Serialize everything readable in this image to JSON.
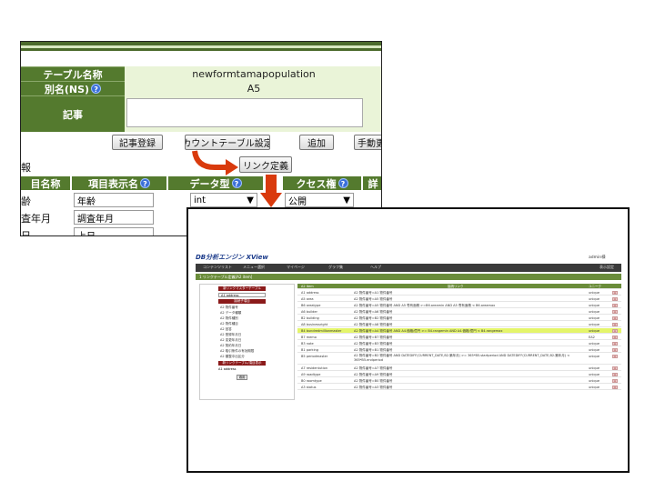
{
  "top": {
    "table_name_label": "テーブル名称",
    "table_name_value": "newformtamapopulation",
    "alias_label": "別名(NS)",
    "alias_value": "A5",
    "article_label": "記事",
    "buttons": {
      "register_article": "記事登録",
      "count_table": "カウントテーブル設定",
      "add": "追加",
      "manual": "手動更"
    },
    "section_label": "報",
    "link_def": "リンク定義",
    "columns": {
      "item_name": "目名称",
      "item_display": "項目表示名",
      "data_type": "データ型",
      "access": "クセス権",
      "extra": "詳"
    },
    "rows": [
      {
        "name": "齢",
        "display": "年齢",
        "type": "int",
        "access": "公開"
      },
      {
        "name": "査年月",
        "display": "調査年月",
        "type": "",
        "access": ""
      },
      {
        "name": "日",
        "display": "上日",
        "type": "",
        "access": ""
      }
    ],
    "colors": {
      "header_green": "#547a2e",
      "value_bg": "#eaf4d8",
      "arrow": "#d93a0d"
    }
  },
  "app": {
    "title": "DB分析エンジン XView",
    "user": "admin様",
    "nav": [
      "コンテンツリスト",
      "メニュー選択",
      "マイページ",
      "グラフ集",
      "ヘルプ"
    ],
    "nav_right": "表示設定",
    "breadcrumb": "1 リンクテーブル定義[A2 item]",
    "left_panel": {
      "btn_source": "新リンクマスターテーブル",
      "select_value": "A1 address",
      "btn_field": "接続子項目",
      "items": [
        "A2 物件番号",
        "A2 データ種類",
        "A2 物件種別",
        "A2 物件種目",
        "A2 回答",
        "A2 登録年月日",
        "A2 変更年月日",
        "A2 契約年月日",
        "A2 取引条件の有効期限",
        "A2 類整中出区分"
      ],
      "btn_target": "新リンクテーブル/項目表示",
      "select_value2": "A1 address",
      "apply": "適用"
    },
    "table_headers": [
      "A2 Item",
      "接続リンク",
      "ユニーク"
    ],
    "table_rows": [
      {
        "item": "A1 address",
        "link": "A2 物件番号=A1 物件番号",
        "uniq": "unique",
        "highlight": false
      },
      {
        "item": "A5 area",
        "link": "A2 物件番号=A5 物件番号",
        "uniq": "unique",
        "highlight": false
      },
      {
        "item": "B6 areatype",
        "link": "A2 物件番号=A5 物件番号 AND A5 専有面積 >=B6.areamin AND A5 専有面積 < B6.areamax",
        "uniq": "unique",
        "highlight": false
      },
      {
        "item": "A6 builder",
        "link": "A2 物件番号=A6 物件番号",
        "uniq": "unique",
        "highlight": false
      },
      {
        "item": "B2 building",
        "link": "A2 物件番号=B2 物件番号",
        "uniq": "unique",
        "highlight": false
      },
      {
        "item": "A8 businessright",
        "link": "A2 物件番号=A8 物件番号",
        "uniq": "unique",
        "highlight": false
      },
      {
        "item": "B4 bundredmillionmaster",
        "link": "A2 物件番号=A4 物件番号 AND A4.価格/億円 >= B4.rangemin AND A4.価格/億円 < B4.rangemax",
        "uniq": "unique",
        "highlight": true
      },
      {
        "item": "B7 memo",
        "link": "A2 物件番号=B7 物件番号",
        "uniq": "EA2",
        "highlight": false
      },
      {
        "item": "B3 note",
        "link": "A2 物件番号=B3 物件番号",
        "uniq": "unique",
        "highlight": false
      },
      {
        "item": "B1 parking",
        "link": "A2 物件番号=B1 物件番号",
        "uniq": "unique",
        "highlight": false
      },
      {
        "item": "B5 periodmaster",
        "link": "A2 物件番号=B2 物件番号 AND DATEDIFF(CURRENT_DATE,B2.築年月) >= 365*B5.startperiod AND DATEDIFF(CURRENT_DATE,B2.築年月) < 365*B5.endperiod",
        "uniq": "unique",
        "highlight": false,
        "tall": true
      },
      {
        "item": "A7 residentution",
        "link": "A2 物件番号=A7 物件番号",
        "uniq": "unique",
        "highlight": false
      },
      {
        "item": "A9 roadtype",
        "link": "A2 物件番号=A9 物件番号",
        "uniq": "unique",
        "highlight": false
      },
      {
        "item": "B0 roomtype",
        "link": "A2 物件番号=B0 物件番号",
        "uniq": "unique",
        "highlight": false
      },
      {
        "item": "A3 status",
        "link": "A2 物件番号=A3 物件番号",
        "uniq": "unique",
        "highlight": false
      }
    ]
  }
}
